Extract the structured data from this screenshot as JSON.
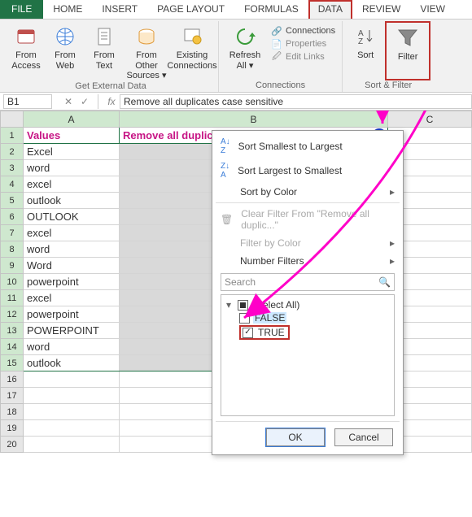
{
  "tabs": {
    "file": "FILE",
    "home": "HOME",
    "insert": "INSERT",
    "page_layout": "PAGE LAYOUT",
    "formulas": "FORMULAS",
    "data": "DATA",
    "review": "REVIEW",
    "view": "VIEW"
  },
  "ribbon": {
    "get_external_data": {
      "label": "Get External Data",
      "from_access": "From\nAccess",
      "from_web": "From\nWeb",
      "from_text": "From\nText",
      "from_other": "From Other\nSources ▾",
      "existing_conn": "Existing\nConnections"
    },
    "connections": {
      "label": "Connections",
      "refresh_all": "Refresh\nAll ▾",
      "connections": "Connections",
      "properties": "Properties",
      "edit_links": "Edit Links"
    },
    "sort_filter": {
      "label": "Sort & Filter",
      "sort": "Sort",
      "filter": "Filter"
    }
  },
  "formula_bar": {
    "name": "B1",
    "fx_label": "fx",
    "text": "Remove all duplicates case sensitive"
  },
  "columns": {
    "A": "A",
    "B": "B",
    "C": "C"
  },
  "headers": {
    "A": "Values",
    "B": "Remove all duplicates case sensitive"
  },
  "rows": [
    "Excel",
    "word",
    "excel",
    "outlook",
    "OUTLOOK",
    "excel",
    "word",
    "Word",
    "powerpoint",
    "excel",
    "powerpoint",
    "POWERPOINT",
    "word",
    "outlook"
  ],
  "row_numbers": [
    1,
    2,
    3,
    4,
    5,
    6,
    7,
    8,
    9,
    10,
    11,
    12,
    13,
    14,
    15,
    16,
    17,
    18,
    19,
    20
  ],
  "filter": {
    "sort_asc": "Sort Smallest to Largest",
    "sort_desc": "Sort Largest to Smallest",
    "sort_color": "Sort by Color",
    "clear": "Clear Filter From \"Remove all duplic...\"",
    "filter_color": "Filter by Color",
    "number_filters": "Number Filters",
    "search_placeholder": "Search",
    "select_all": "(Select All)",
    "false": "FALSE",
    "true": "TRUE",
    "ok": "OK",
    "cancel": "Cancel"
  }
}
